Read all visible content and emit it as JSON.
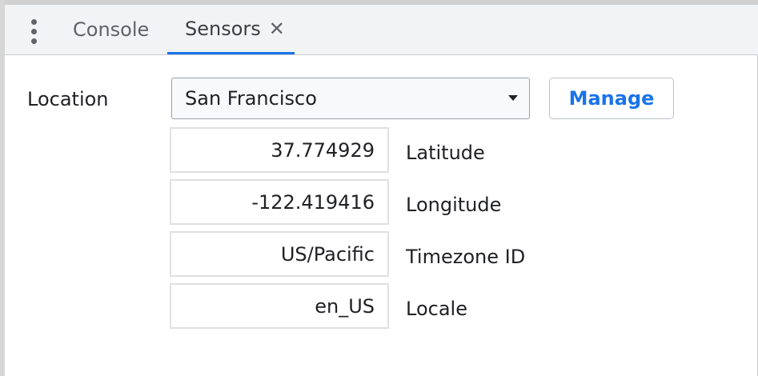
{
  "tabs": [
    {
      "label": "Console"
    },
    {
      "label": "Sensors",
      "active": true,
      "close_glyph": "✕"
    }
  ],
  "location": {
    "label": "Location",
    "selected": "San Francisco",
    "manage_label": "Manage"
  },
  "fields": [
    {
      "value": "37.774929",
      "label": "Latitude"
    },
    {
      "value": "-122.419416",
      "label": "Longitude"
    },
    {
      "value": "US/Pacific",
      "label": "Timezone ID"
    },
    {
      "value": "en_US",
      "label": "Locale"
    }
  ],
  "colors": {
    "accent": "#1a73e8",
    "tab_bar": "#f1f3f4"
  },
  "icons": {
    "menu": "more-vertical-icon",
    "close": "close-icon",
    "dropdown": "chevron-down-icon"
  }
}
